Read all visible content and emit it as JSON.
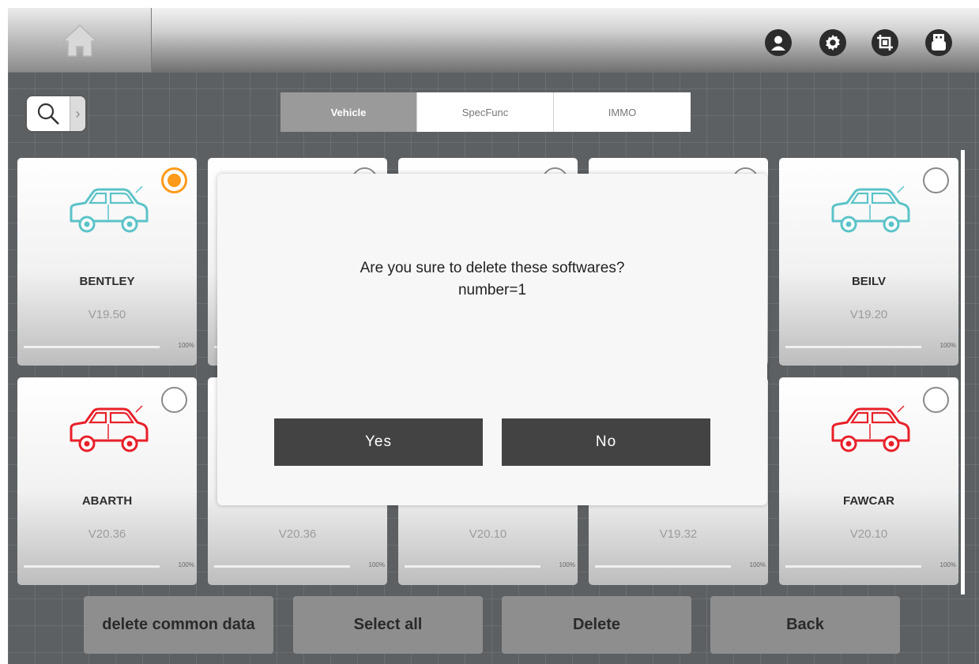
{
  "topbar": {
    "right_icons": [
      "user-icon",
      "gear-icon",
      "crop-icon",
      "usb-icon"
    ]
  },
  "search": {
    "icon": "search-icon",
    "arrow": "›"
  },
  "tabs": [
    {
      "label": "Vehicle",
      "active": true
    },
    {
      "label": "SpecFunc",
      "active": false
    },
    {
      "label": "IMMO",
      "active": false
    }
  ],
  "cards": [
    {
      "name": "BENTLEY",
      "version": "V19.50",
      "progress": "100%",
      "selected": true,
      "car_color": "#5bc3c8"
    },
    {
      "name": "",
      "version": "",
      "progress": "100%",
      "selected": false,
      "car_color": ""
    },
    {
      "name": "",
      "version": "",
      "progress": "100%",
      "selected": false,
      "car_color": ""
    },
    {
      "name": "",
      "version": "",
      "progress": "100%",
      "selected": false,
      "car_color": ""
    },
    {
      "name": "BEILV",
      "version": "V19.20",
      "progress": "100%",
      "selected": false,
      "car_color": "#5bc3c8"
    },
    {
      "name": "ABARTH",
      "version": "V20.36",
      "progress": "100%",
      "selected": false,
      "car_color": "#e8202a"
    },
    {
      "name": "",
      "version": "V20.36",
      "progress": "100%",
      "selected": false,
      "car_color": ""
    },
    {
      "name": "",
      "version": "V20.10",
      "progress": "100%",
      "selected": false,
      "car_color": ""
    },
    {
      "name": "",
      "version": "V19.32",
      "progress": "100%",
      "selected": false,
      "car_color": ""
    },
    {
      "name": "FAWCAR",
      "version": "V20.10",
      "progress": "100%",
      "selected": false,
      "car_color": "#e8202a"
    }
  ],
  "bottom_buttons": {
    "delete_common": "delete common data",
    "select_all": "Select all",
    "delete": "Delete",
    "back": "Back"
  },
  "dialog": {
    "message": "Are you sure  to delete these softwares?",
    "detail": "number=1",
    "yes": "Yes",
    "no": "No"
  }
}
